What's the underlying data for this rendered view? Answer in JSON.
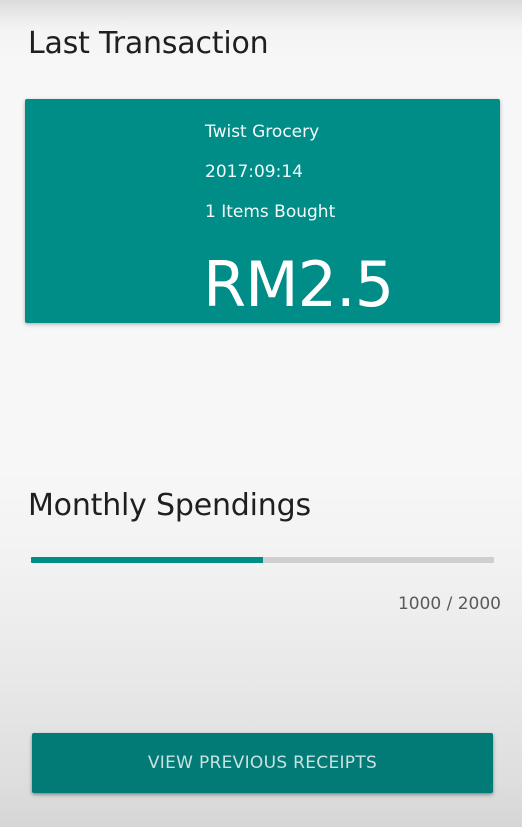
{
  "last_transaction": {
    "title": "Last Transaction",
    "store": "Twist Grocery",
    "date": "2017:09:14",
    "items_bought": "1 Items Bought",
    "amount": "RM2.5"
  },
  "monthly_spendings": {
    "title": "Monthly Spendings",
    "progress_fraction": 0.5,
    "readout": "1000 / 2000"
  },
  "actions": {
    "view_previous_receipts_label": "VIEW PREVIOUS RECEIPTS"
  },
  "colors": {
    "accent": "#008c87",
    "track": "#cfcfcf",
    "button": "#027a76"
  }
}
